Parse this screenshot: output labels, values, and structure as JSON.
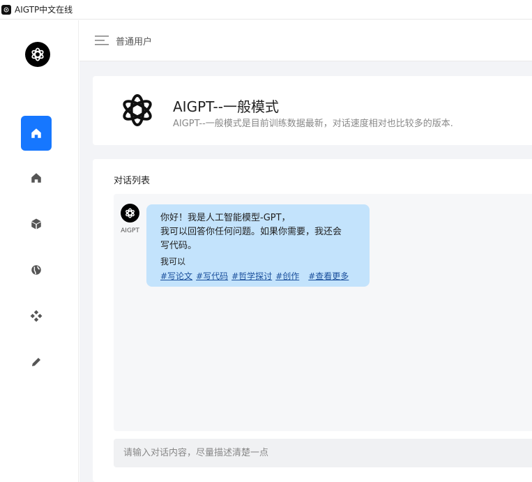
{
  "window": {
    "title": "AIGTP中文在线"
  },
  "header": {
    "user_label": "普通用户"
  },
  "sidebar": {
    "items": [
      {
        "icon": "home-icon",
        "active": true
      },
      {
        "icon": "home-icon",
        "active": false
      },
      {
        "icon": "cube-icon",
        "active": false
      },
      {
        "icon": "globe-icon",
        "active": false
      },
      {
        "icon": "diamonds-icon",
        "active": false
      },
      {
        "icon": "pencil-icon",
        "active": false
      }
    ]
  },
  "model": {
    "title": "AIGPT--一般模式",
    "description": "AIGPT--一般模式是目前训练数据最新，对话速度相对也比较多的版本."
  },
  "chat": {
    "list_title": "对话列表",
    "bot_name": "AIGPT",
    "message": {
      "line1": "你好！我是人工智能模型-GPT，",
      "line2": "我可以回答你任何问题。如果你需要，我还会",
      "line3": "写代码。",
      "sub": "我可以",
      "tags": [
        "#写论文",
        "#写代码",
        "#哲学探讨",
        "#创作"
      ],
      "more": "#查看更多"
    },
    "input_placeholder": "请输入对话内容，尽量描述清楚一点"
  },
  "colors": {
    "accent": "#1677ff",
    "bubble": "#c3e3fc",
    "tag_link": "#1a4f9c"
  }
}
